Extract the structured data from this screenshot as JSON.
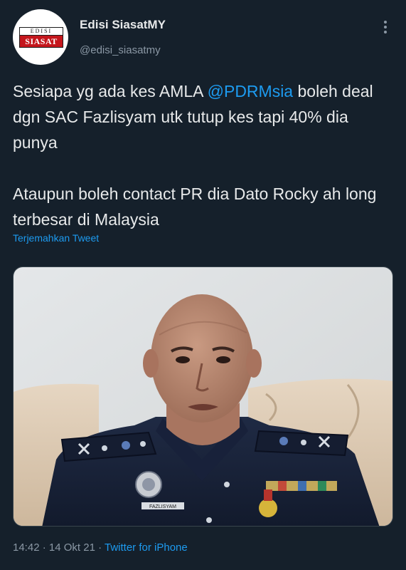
{
  "author": {
    "display_name": "Edisi SiasatMY",
    "handle": "@edisi_siasatmy",
    "avatar_logo_top": "EDISI",
    "avatar_logo_bottom": "SIASAT"
  },
  "tweet": {
    "line1_before": "Sesiapa yg ada kes AMLA ",
    "mention": "@PDRMsia",
    "line1_after": " boleh deal dgn SAC Fazlisyam utk tutup kes tapi 40% dia punya",
    "paragraph2": "Ataupun boleh contact PR dia Dato Rocky ah long terbesar di Malaysia"
  },
  "translate_label": "Terjemahkan Tweet",
  "media": {
    "nametag_text": "FAZLISYAM"
  },
  "meta": {
    "time": "14:42",
    "separator": " · ",
    "date": "14 Okt 21",
    "source": "Twitter for iPhone"
  },
  "colors": {
    "background": "#15202b",
    "text": "#e7e9ea",
    "secondary": "#8b98a5",
    "link": "#1d9bf0",
    "brand_red": "#c4161c"
  }
}
